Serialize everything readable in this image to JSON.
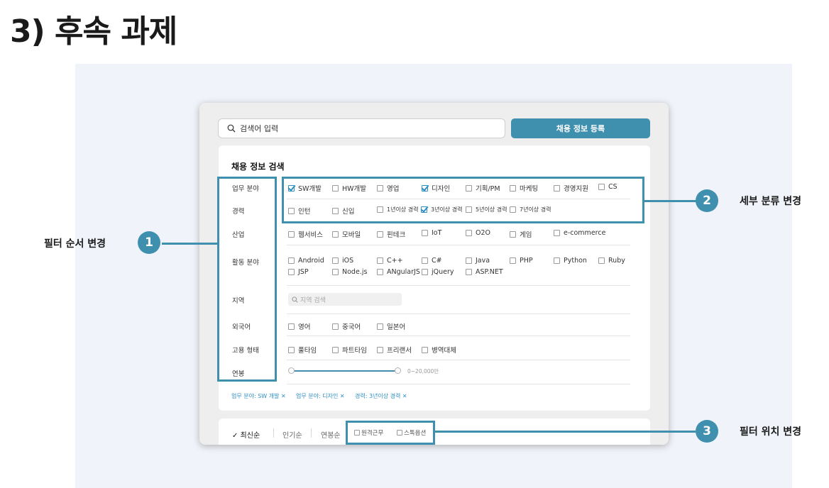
{
  "slide_title": "3) 후속 과제",
  "search": {
    "placeholder": "검색어 입력"
  },
  "register_button": "채용 정보 등록",
  "panel_title": "채용 정보 검색",
  "rows": [
    {
      "label": "업무 분야",
      "options": [
        {
          "text": "SW개발",
          "checked": true
        },
        {
          "text": "HW개발",
          "checked": false
        },
        {
          "text": "영업",
          "checked": false
        },
        {
          "text": "디자인",
          "checked": true
        },
        {
          "text": "기획/PM",
          "checked": false
        },
        {
          "text": "마케팅",
          "checked": false
        },
        {
          "text": "경영지원",
          "checked": false
        },
        {
          "text": "CS",
          "checked": false
        }
      ]
    },
    {
      "label": "경력",
      "options": [
        {
          "text": "인턴",
          "checked": false
        },
        {
          "text": "신입",
          "checked": false
        },
        {
          "text": "1년이상 경력",
          "checked": false
        },
        {
          "text": "3년이상 경력",
          "checked": true
        },
        {
          "text": "5년이상 경력",
          "checked": false
        },
        {
          "text": "7년이상 경력",
          "checked": false
        }
      ]
    },
    {
      "label": "산업",
      "options": [
        {
          "text": "웹서비스",
          "checked": false
        },
        {
          "text": "모바일",
          "checked": false
        },
        {
          "text": "핀테크",
          "checked": false
        },
        {
          "text": "IoT",
          "checked": false
        },
        {
          "text": "O2O",
          "checked": false
        },
        {
          "text": "게임",
          "checked": false
        },
        {
          "text": "e-commerce",
          "checked": false
        }
      ]
    },
    {
      "label": "활동 분야",
      "options": [
        {
          "text": "Android",
          "checked": false
        },
        {
          "text": "iOS",
          "checked": false
        },
        {
          "text": "C++",
          "checked": false
        },
        {
          "text": "C#",
          "checked": false
        },
        {
          "text": "Java",
          "checked": false
        },
        {
          "text": "PHP",
          "checked": false
        },
        {
          "text": "Python",
          "checked": false
        },
        {
          "text": "Ruby",
          "checked": false
        },
        {
          "text": "JSP",
          "checked": false
        },
        {
          "text": "Node.js",
          "checked": false
        },
        {
          "text": "ANgularJS",
          "checked": false
        },
        {
          "text": "jQuery",
          "checked": false
        },
        {
          "text": "ASP.NET",
          "checked": false
        }
      ]
    },
    {
      "label": "지역",
      "search_placeholder": "지역 검색"
    },
    {
      "label": "외국어",
      "options": [
        {
          "text": "영어",
          "checked": false
        },
        {
          "text": "중국어",
          "checked": false
        },
        {
          "text": "일본어",
          "checked": false
        }
      ]
    },
    {
      "label": "고용 형태",
      "options": [
        {
          "text": "풀타임",
          "checked": false
        },
        {
          "text": "파트타임",
          "checked": false
        },
        {
          "text": "프리랜서",
          "checked": false
        },
        {
          "text": "병역대체",
          "checked": false
        }
      ]
    },
    {
      "label": "연봉",
      "slider_value": "0~20,000만"
    }
  ],
  "chips": [
    "업무 분야: SW 개발 ✕",
    "업무 분야: 디자인 ✕",
    "경력: 3년이상 경력 ✕"
  ],
  "sort": {
    "items": [
      "✓ 최신순",
      "인기순",
      "연봉순"
    ],
    "filters": [
      "원격근무",
      "스톡옵션"
    ]
  },
  "callouts": [
    {
      "number": "1",
      "text": "필터 순서 변경"
    },
    {
      "number": "2",
      "text": "세부 분류 변경"
    },
    {
      "number": "3",
      "text": "필터 위치 변경"
    }
  ],
  "colors": {
    "accent": "#3f8fae",
    "check": "#2f8fc4"
  }
}
